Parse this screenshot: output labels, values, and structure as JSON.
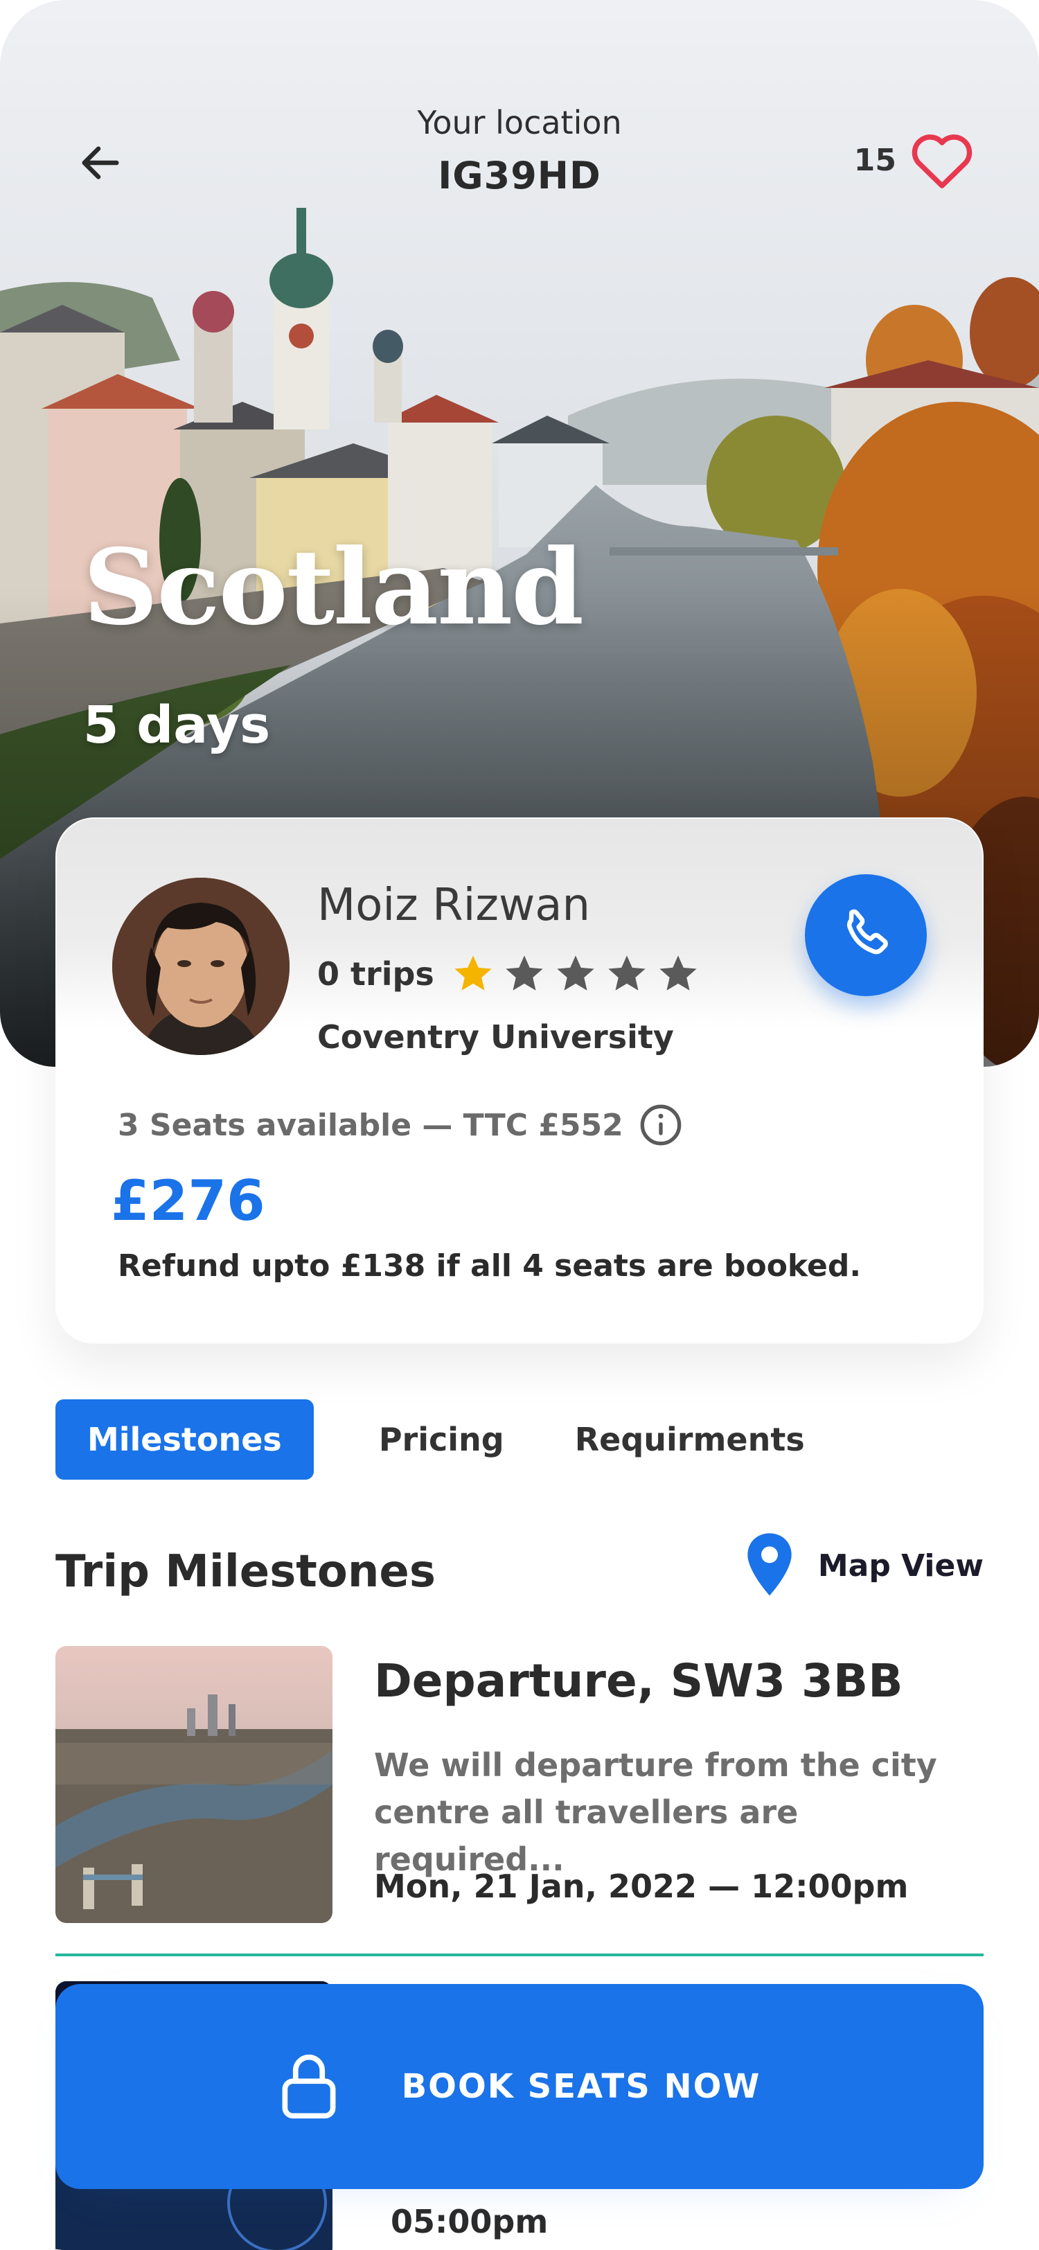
{
  "header": {
    "location_label": "Your location",
    "location_value": "IG39HD",
    "likes_count": "15"
  },
  "hero": {
    "title": "Scotland",
    "duration": "5 days"
  },
  "driver": {
    "name": "Moiz Rizwan",
    "trips": "0 trips",
    "rating": 1,
    "rating_max": 5,
    "university": "Coventry University",
    "seats_text": "3 Seats available — TTC £552",
    "price": "£276",
    "refund_text": "Refund upto £138 if all 4 seats are booked."
  },
  "tabs": [
    {
      "label": "Milestones",
      "active": true
    },
    {
      "label": "Pricing",
      "active": false
    },
    {
      "label": "Requirments",
      "active": false
    }
  ],
  "milestones": {
    "title": "Trip Milestones",
    "map_view_label": "Map View",
    "items": [
      {
        "title": "Departure, SW3 3BB",
        "description": "We will departure from the city centre all travellers are required...",
        "time": "Mon, 21 Jan, 2022 — 12:00pm"
      },
      {
        "time": "05:00pm"
      }
    ]
  },
  "book_button": {
    "label": "BOOK SEATS NOW"
  },
  "colors": {
    "accent": "#1a73e8",
    "heart": "#e8384f",
    "star_active": "#f5b400",
    "star_inactive": "#5a5a5a",
    "divider": "#26b79a"
  },
  "icons": [
    "back-arrow-icon",
    "heart-icon",
    "phone-icon",
    "star-icon",
    "info-icon",
    "map-pin-icon",
    "lock-icon"
  ]
}
